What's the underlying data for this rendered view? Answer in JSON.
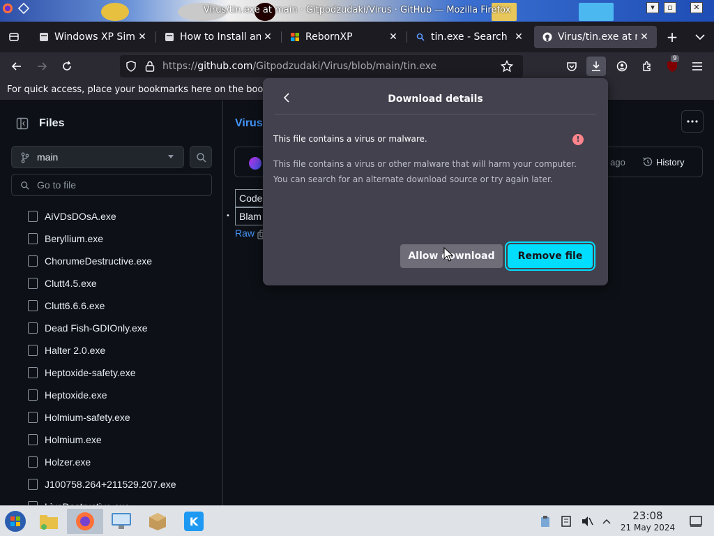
{
  "window": {
    "title": "Virus/tin.exe at main · Gitpodzudaki/Virus · GitHub — Mozilla Firefox",
    "minimize": "▾",
    "maximize": "▫",
    "close": "✕"
  },
  "tabs": [
    {
      "label": "Windows XP Simul",
      "favicon": "page-icon",
      "active": false
    },
    {
      "label": "How to Install and",
      "favicon": "page-icon",
      "active": false
    },
    {
      "label": "RebornXP",
      "favicon": "windows-icon",
      "active": false
    },
    {
      "label": "tin.exe - Search",
      "favicon": "search-icon",
      "active": false
    },
    {
      "label": "Virus/tin.exe at m",
      "favicon": "github-icon",
      "active": true
    }
  ],
  "nav": {
    "url_prefix": "https://",
    "url_host": "github.com",
    "url_path": "/Gitpodzudaki/Virus/blob/main/tin.exe",
    "extension_badge": "9"
  },
  "bookmarks_bar": {
    "text": "For quick access, place your bookmarks here on the bookmarks toolbar."
  },
  "sidebar": {
    "title": "Files",
    "branch": "main",
    "goto_placeholder": "Go to file",
    "files": [
      "AiVDsDOsA.exe",
      "Beryllium.exe",
      "ChorumeDestructive.exe",
      "Clutt4.5.exe",
      "Clutt6.6.6.exe",
      "Dead Fish-GDIOnly.exe",
      "Halter 2.0.exe",
      "Heptoxide-safety.exe",
      "Heptoxide.exe",
      "Holmium-safety.exe",
      "Holmium.exe",
      "Holzer.exe",
      "J100758.264+211529.207.exe",
      "LiveDestructive.exe"
    ]
  },
  "main": {
    "breadcrumb": "Virus",
    "commit_time": "s ago",
    "history": "History",
    "code_tab": "Code",
    "blame_tab": "Blam",
    "raw_link": "Raw"
  },
  "popup": {
    "title": "Download details",
    "heading": "This file contains a virus or malware.",
    "body_line1": "This file contains a virus or other malware that will harm your computer.",
    "body_line2": "You can search for an alternate download source or try again later.",
    "allow_label": "Allow download",
    "remove_label": "Remove file"
  },
  "taskbar": {
    "time": "23:08",
    "date": "21 May 2024"
  },
  "colors": {
    "accent": "#00ddff",
    "warning": "#ff848b",
    "link": "#4493f8"
  }
}
